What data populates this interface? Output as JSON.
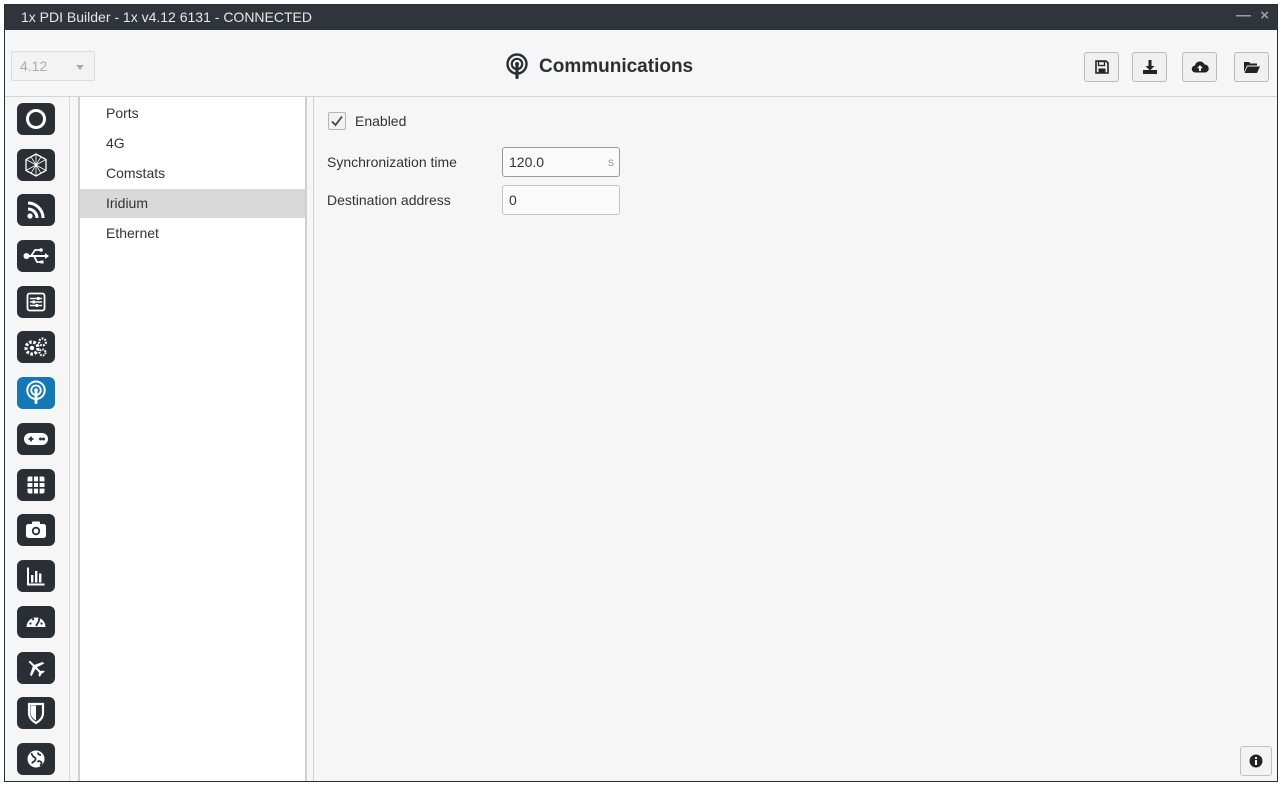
{
  "window": {
    "title": "1x PDI Builder - 1x v4.12 6131 - CONNECTED",
    "minimize_glyph": "—",
    "close_glyph": "×"
  },
  "header": {
    "version_value": "4.12",
    "title": "Communications",
    "title_icon": "broadcast-icon",
    "toolbar": [
      {
        "name": "save-button",
        "icon": "save-icon"
      },
      {
        "name": "download-button",
        "icon": "download-icon"
      },
      {
        "name": "cloud-upload-button",
        "icon": "cloud-upload-icon"
      },
      {
        "name": "open-folder-button",
        "icon": "folder-open-icon"
      }
    ]
  },
  "sidebar": {
    "items": [
      {
        "icon": "circle-ring-icon",
        "active": false
      },
      {
        "icon": "hexagon-mesh-icon",
        "active": false
      },
      {
        "icon": "rss-feed-icon",
        "active": false
      },
      {
        "icon": "usb-icon",
        "active": false
      },
      {
        "icon": "sliders-icon",
        "active": false
      },
      {
        "icon": "gears-icon",
        "active": false
      },
      {
        "icon": "broadcast-icon",
        "active": true
      },
      {
        "icon": "gamepad-icon",
        "active": false
      },
      {
        "icon": "grid-icon",
        "active": false
      },
      {
        "icon": "camera-icon",
        "active": false
      },
      {
        "icon": "bar-chart-icon",
        "active": false
      },
      {
        "icon": "gauge-icon",
        "active": false
      },
      {
        "icon": "airplane-icon",
        "active": false
      },
      {
        "icon": "shield-icon",
        "active": false
      },
      {
        "icon": "globe-icon",
        "active": false
      }
    ]
  },
  "subnav": {
    "items": [
      {
        "label": "Ports",
        "selected": false
      },
      {
        "label": "4G",
        "selected": false
      },
      {
        "label": "Comstats",
        "selected": false
      },
      {
        "label": "Iridium",
        "selected": true
      },
      {
        "label": "Ethernet",
        "selected": false
      }
    ]
  },
  "form": {
    "enabled_label": "Enabled",
    "enabled_checked": true,
    "sync_time_label": "Synchronization time",
    "sync_time_value": "120.0",
    "sync_time_unit": "s",
    "dest_address_label": "Destination address",
    "dest_address_value": "0"
  },
  "colors": {
    "titlebar": "#2f353b",
    "sidebar_icon_bg": "#2a2f35",
    "sidebar_active_bg": "#1478b4",
    "selected_nav_bg": "#d9d9d9"
  }
}
